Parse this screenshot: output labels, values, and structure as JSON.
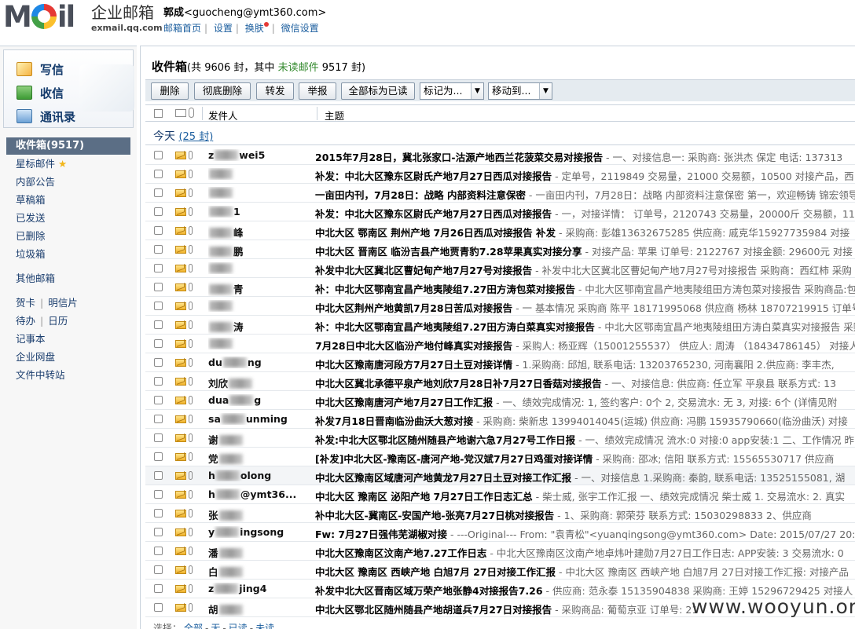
{
  "header": {
    "logo_text": "MOil",
    "brand_cn": "企业邮箱",
    "brand_domain": "exmail.qq.com",
    "user_name": "郭成",
    "user_email": "<guocheng@ymt360.com>",
    "links": [
      "邮箱首页",
      "设置",
      "换肤",
      "微信设置"
    ]
  },
  "quick_actions": [
    "写信",
    "收信",
    "通讯录"
  ],
  "folders": {
    "active": "收件箱(9517)",
    "items": [
      "星标邮件",
      "内部公告",
      "草稿箱",
      "已发送",
      "已删除",
      "垃圾箱"
    ],
    "other": "其他邮箱",
    "tools": [
      [
        "贺卡",
        "明信片"
      ],
      [
        "待办",
        "日历"
      ],
      [
        "记事本"
      ],
      [
        "企业网盘"
      ],
      [
        "文件中转站"
      ]
    ]
  },
  "inbox": {
    "title": "收件箱",
    "summary_prefix": "(共 9606 封，其中 ",
    "unread_label": "未读邮件",
    "summary_suffix": " 9517 封)"
  },
  "toolbar": {
    "buttons": [
      "删除",
      "彻底删除",
      "转发",
      "举报",
      "全部标为已读"
    ],
    "mark_as": "标记为...",
    "move_to": "移动到..."
  },
  "columns": {
    "sender": "发件人",
    "subject": "主题"
  },
  "group": {
    "label": "今天",
    "count": "(25 封)"
  },
  "emails": [
    {
      "sender_pre": "z",
      "sender_post": "wei5",
      "subject": "2015年7月28日，冀北张家口-沽源产地西兰花菠菜交易对接报告",
      "preview": " - 一、对接信息一:  采购商: 张洪杰 保定 电话: 137313"
    },
    {
      "sender_pre": "",
      "sender_post": "",
      "subject": "补发：中北大区豫东区尉氏产地7月27日西瓜对接报告",
      "preview": " - 定单号，2119849 交易量，21000 交易额，10500 对接产品，西"
    },
    {
      "sender_pre": "",
      "sender_post": "",
      "subject": "一亩田内刊，7月28日：战略 内部资料注意保密",
      "preview": " - 一亩田内刊，7月28日：战略 内部资料注意保密 第一，欢迎畅铸 锦宏领导"
    },
    {
      "sender_pre": "",
      "sender_post": "1",
      "subject": "补发：中北大区豫东区尉氏产地7月27日西瓜对接报告",
      "preview": " - 一，对接详情：  订单号，2120743 交易量，20000斤 交易额，11"
    },
    {
      "sender_pre": "",
      "sender_post": "峰",
      "subject": "中北大区 鄂南区 荆州产地 7月26日西瓜对接报告 补发",
      "preview": " - 采购商: 彭雄13632675285 供应商: 戚克华15927735984 对接"
    },
    {
      "sender_pre": "",
      "sender_post": "鹏",
      "subject": "中北大区 晋南区 临汾吉县产地贾青豹7.28苹果真实对接分享",
      "preview": " - 对接产品: 苹果 订单号: 2122767 对接金额: 29600元 对接"
    },
    {
      "sender_pre": "",
      "sender_post": "",
      "subject": "补发中北大区冀北区曹妃甸产地7月27号对接报告",
      "preview": " - 补发中北大区冀北区曹妃甸产地7月27号对接报告 采购商：西红柿 采购"
    },
    {
      "sender_pre": "",
      "sender_post": "青",
      "subject": "补：中北大区鄂南宜昌产地夷陵组7.27田方涛包菜对接报告",
      "preview": " - 中北大区鄂南宜昌产地夷陵组田方涛包菜对接报告 采购商品:包"
    },
    {
      "sender_pre": "",
      "sender_post": "",
      "subject": "中北大区荆州产地黄凯7月28日苦瓜对接报告",
      "preview": " - 一 基本情况 采购商 陈平 18171995068 供应商 杨林 18707219915 订单号"
    },
    {
      "sender_pre": "",
      "sender_post": "涛",
      "subject": "补：中北大区鄂南宜昌产地夷陵组7.27田方涛白菜真实对接报告",
      "preview": " - 中北大区鄂南宜昌产地夷陵组田方涛白菜真实对接报告 采购"
    },
    {
      "sender_pre": "",
      "sender_post": "",
      "subject": "7月28日中北大区临汾产地付峰真实对接报告",
      "preview": " - 采购人: 杨亚辉（15001255537） 供应人: 周涛 （18434786145） 对接人"
    },
    {
      "sender_pre": "du",
      "sender_post": "ng",
      "subject": "中北大区豫南唐河段方7月27日土豆对接详情",
      "preview": " - 1.采购商: 邱旭, 联系电话: 13203765230, 河南襄阳 2.供应商: 李丰杰, "
    },
    {
      "sender_pre": "刘欣",
      "sender_post": "",
      "subject": "中北大区冀北承德平泉产地刘欣7月28日补7月27日香菇对接报告",
      "preview": " - 一、对接信息: 供应商: 任立军 平泉县 联系方式: 13"
    },
    {
      "sender_pre": "dua",
      "sender_post": "g",
      "subject": "中北大区豫南唐河产地7月27日工作汇报",
      "preview": " - 一、绩效完成情况:  1, 签约客户: 0个 2, 交易流水: 无 3, 对接: 6个 (详情见附"
    },
    {
      "sender_pre": "sa",
      "sender_post": "unming",
      "subject": "补发7月18日晋南临汾曲沃大葱对接",
      "preview": " - 采购商: 柴新忠 13994014045(运城)  供应商: 冯鹏 15935790660(临汾曲沃)  对接"
    },
    {
      "sender_pre": "谢",
      "sender_post": "",
      "subject": "补发:中北大区鄂北区随州随县产地谢六急7月27号工作日报",
      "preview": " - 一、绩效完成情况 流水:0 对接:0 app安装:1 二、工作情况 昨"
    },
    {
      "sender_pre": "党",
      "sender_post": "",
      "subject": "[补发]中北大区-豫南区-唐河产地-党汉斌7月27日鸡蛋对接详情",
      "preview": " - 采购商: 邵冰; 信阳 联系方式: 15565530717 供应商"
    },
    {
      "sender_pre": "h",
      "sender_post": "olong",
      "subject": "中北大区豫南区域唐河产地黄龙7月27日土豆对接工作汇报",
      "preview": " - 一、对接信息 1.采购商: 秦韵, 联系电话: 13525155081, 湖"
    },
    {
      "sender_pre": "h",
      "sender_post": "@ymt36...",
      "subject": "中北大区 豫南区 泌阳产地  7月27日工作日志汇总",
      "preview": " - 柴士威, 张宇工作汇报 一、绩效完成情况 柴士威 1. 交易流水:  2. 真实"
    },
    {
      "sender_pre": "张",
      "sender_post": "",
      "subject": "补中北大区-冀南区-安国产地-张亮7月27日桃对接报告",
      "preview": " - 1、采购商: 郭荣芬 联系方式: 15030298833 2、供应商"
    },
    {
      "sender_pre": "y",
      "sender_post": "ingsong",
      "subject": "Fw: 7月27日强伟芜湖椒对接",
      "preview": " - ---Original--- From: \"袁青松\"<yuanqingsong@ymt360.com> Date: 2015/07/27 20:"
    },
    {
      "sender_pre": "潘",
      "sender_post": "",
      "subject": "中北大区豫南区汶南产地7.27工作日志",
      "preview": " - 中北大区豫南区汶南产地卓炜叶建勋7月27日工作日志:  APP安装: 3 交易流水: 0"
    },
    {
      "sender_pre": "白",
      "sender_post": "",
      "subject": "中北大区 豫南区 西峡产地  白旭7月 27日对接工作汇报",
      "preview": " - 中北大区 豫南区 西峡产地 白旭7月 27日对接工作汇报:  对接产品"
    },
    {
      "sender_pre": "z",
      "sender_post": "jing4",
      "subject": "补发中北大区晋南区域万荣产地张静4对接报告7.26",
      "preview": " - 供应商: 范永泰 15135904838 采购商: 王婷 15296729425 对接人"
    },
    {
      "sender_pre": "胡",
      "sender_post": "",
      "subject": "中北大区鄂北区随州随县产地胡道兵7月27日对接报告",
      "preview": " - 采购商品: 葡萄京亚 订单号: 21"
    }
  ],
  "footer": {
    "label": "选择：",
    "options": [
      "全部",
      "无",
      "已读",
      "未读"
    ]
  },
  "watermark": "www.wooyun.org"
}
